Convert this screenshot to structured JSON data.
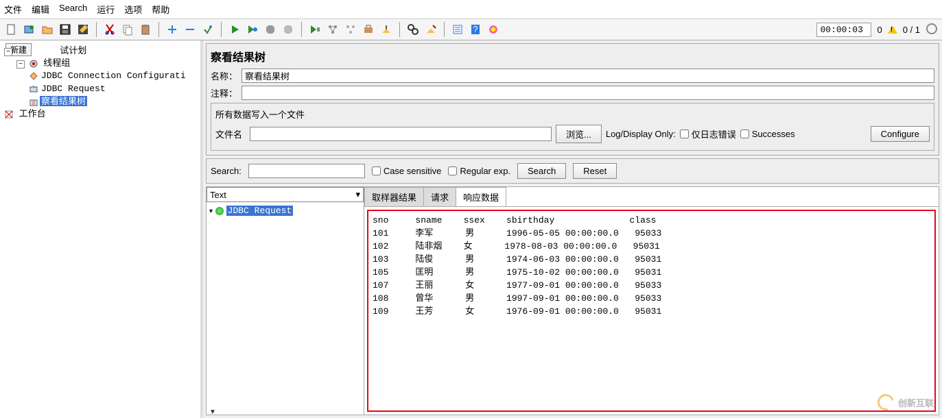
{
  "menu": {
    "file": "文件",
    "edit": "编辑",
    "search": "Search",
    "run": "运行",
    "options": "选项",
    "help": "帮助"
  },
  "toolbar": {
    "timer": "00:00:03",
    "warn_count": "0",
    "counter": "0 / 1"
  },
  "tree": {
    "new_btn": "新建",
    "root": "试计划",
    "thread_group": "线程组",
    "jdbc_conf": "JDBC Connection Configurati",
    "jdbc_req": "JDBC Request",
    "view_results": "察看结果树",
    "workbench": "工作台"
  },
  "panel": {
    "title": "察看结果树",
    "name_label": "名称：",
    "name_value": "察看结果树",
    "comment_label": "注释：",
    "file_section_title": "所有数据写入一个文件",
    "filename_label": "文件名",
    "browse_btn": "浏览...",
    "log_display": "Log/Display Only:",
    "errors_only": "仅日志错误",
    "successes": "Successes",
    "configure_btn": "Configure"
  },
  "searchbar": {
    "label": "Search:",
    "case_sensitive": "Case sensitive",
    "regex": "Regular exp.",
    "search_btn": "Search",
    "reset_btn": "Reset"
  },
  "results": {
    "combo": "Text",
    "sample": "JDBC Request",
    "tabs": {
      "sampler": "取样器结果",
      "request": "请求",
      "response": "响应数据"
    }
  },
  "response_text": "sno     sname    ssex    sbirthday              class\n101     李军      男      1996-05-05 00:00:00.0   95033\n102     陆非烟    女      1978-08-03 00:00:00.0   95031\n103     陆俊      男      1974-06-03 00:00:00.0   95031\n105     匡明      男      1975-10-02 00:00:00.0   95031\n107     王丽      女      1977-09-01 00:00:00.0   95033\n108     曾华      男      1997-09-01 00:00:00.0   95033\n109     王芳      女      1976-09-01 00:00:00.0   95031",
  "chart_data": {
    "type": "table",
    "columns": [
      "sno",
      "sname",
      "ssex",
      "sbirthday",
      "class"
    ],
    "rows": [
      [
        "101",
        "李军",
        "男",
        "1996-05-05 00:00:00.0",
        "95033"
      ],
      [
        "102",
        "陆非烟",
        "女",
        "1978-08-03 00:00:00.0",
        "95031"
      ],
      [
        "103",
        "陆俊",
        "男",
        "1974-06-03 00:00:00.0",
        "95031"
      ],
      [
        "105",
        "匡明",
        "男",
        "1975-10-02 00:00:00.0",
        "95031"
      ],
      [
        "107",
        "王丽",
        "女",
        "1977-09-01 00:00:00.0",
        "95033"
      ],
      [
        "108",
        "曾华",
        "男",
        "1997-09-01 00:00:00.0",
        "95033"
      ],
      [
        "109",
        "王芳",
        "女",
        "1976-09-01 00:00:00.0",
        "95031"
      ]
    ]
  },
  "watermark": "创新互联"
}
